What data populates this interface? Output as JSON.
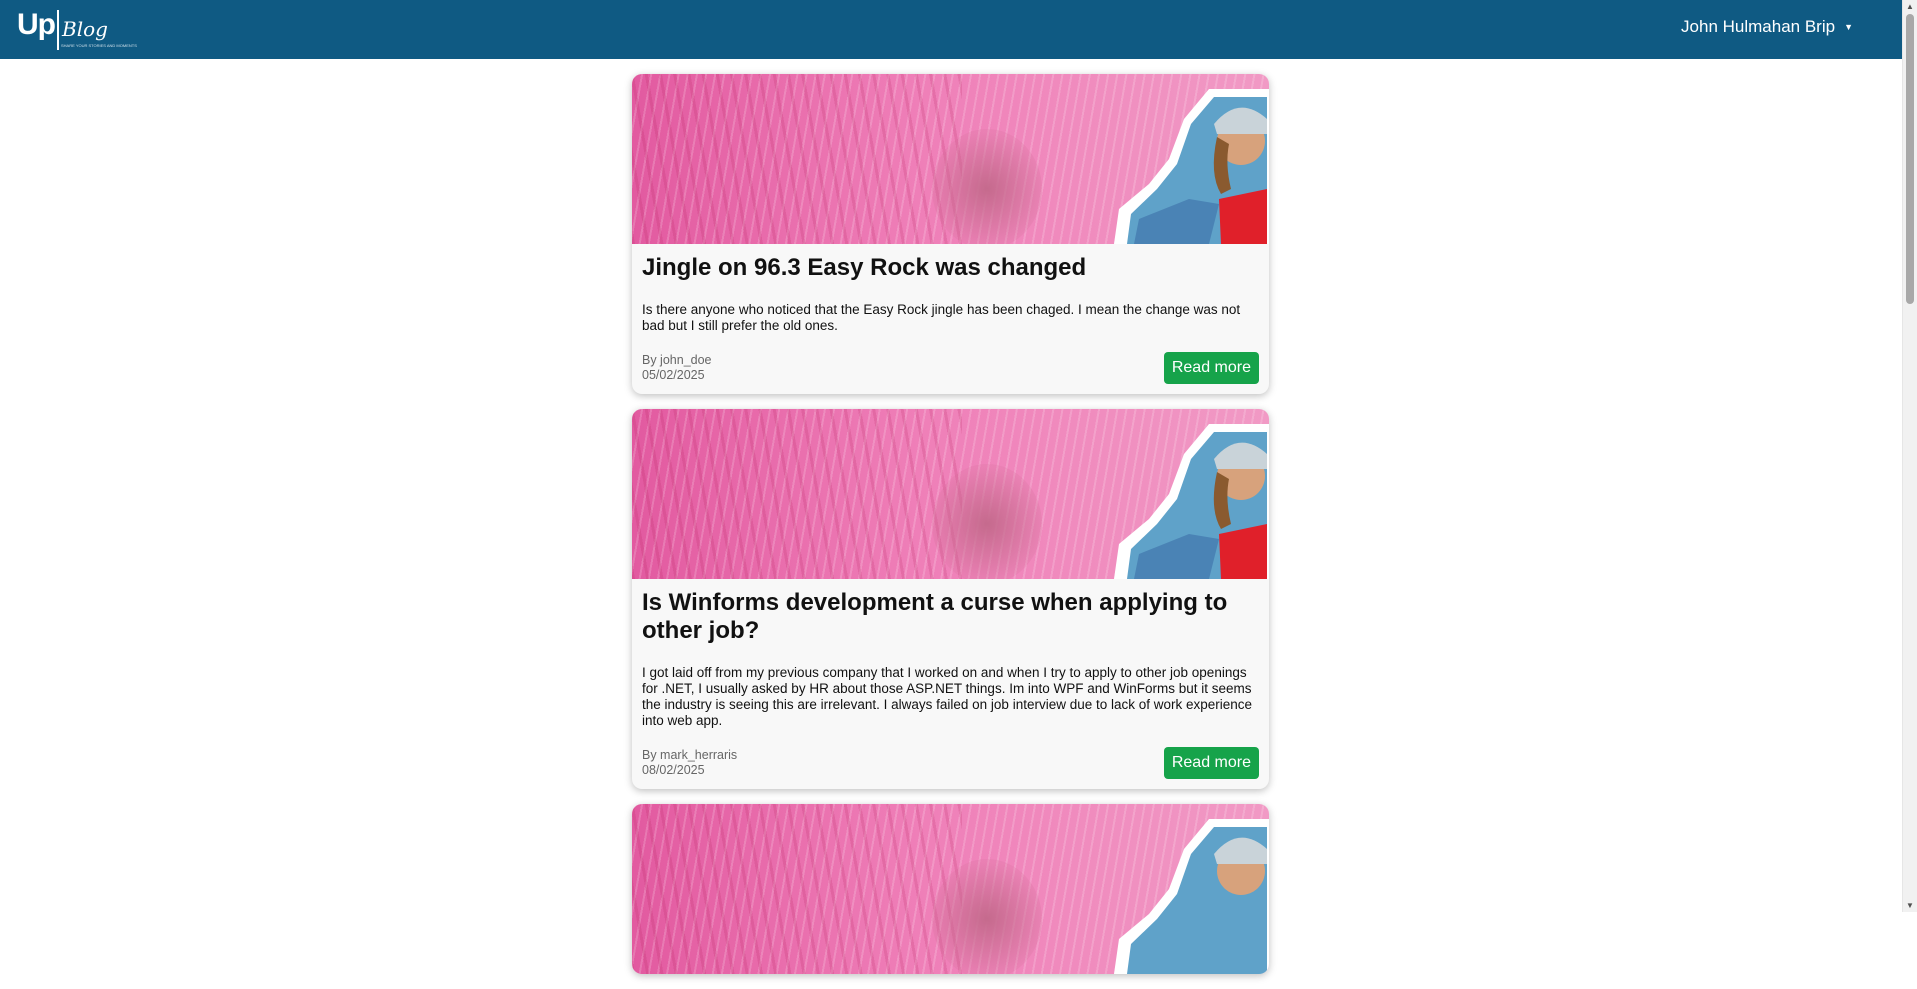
{
  "header": {
    "logo_main": "Up",
    "logo_sub": "Blog",
    "tagline": "SHARE YOUR STORIES AND MOMENTS",
    "user_name": "John Hulmahan Brip",
    "bg_color": "#0f5a83"
  },
  "posts": [
    {
      "title": "Jingle on 96.3 Easy Rock was changed",
      "excerpt": "Is there anyone who noticed that the Easy Rock jingle has been chaged. I mean the change was not bad but I still prefer the old ones.",
      "author": "By john_doe",
      "date": "05/02/2025",
      "read_more_label": "Read more"
    },
    {
      "title": "Is Winforms development a curse when applying to other job?",
      "excerpt": "I got laid off from my previous company that I worked on and when I try to apply to other job openings for .NET, I usually asked by HR about those ASP.NET things. Im into WPF and WinForms but it seems the industry is seeing this are irrelevant. I always failed on job interview due to lack of work experience into web app.",
      "author": "By mark_herraris",
      "date": "08/02/2025",
      "read_more_label": "Read more"
    }
  ],
  "colors": {
    "accent_button": "#16a34a",
    "card_background": "#f8f8f8"
  }
}
